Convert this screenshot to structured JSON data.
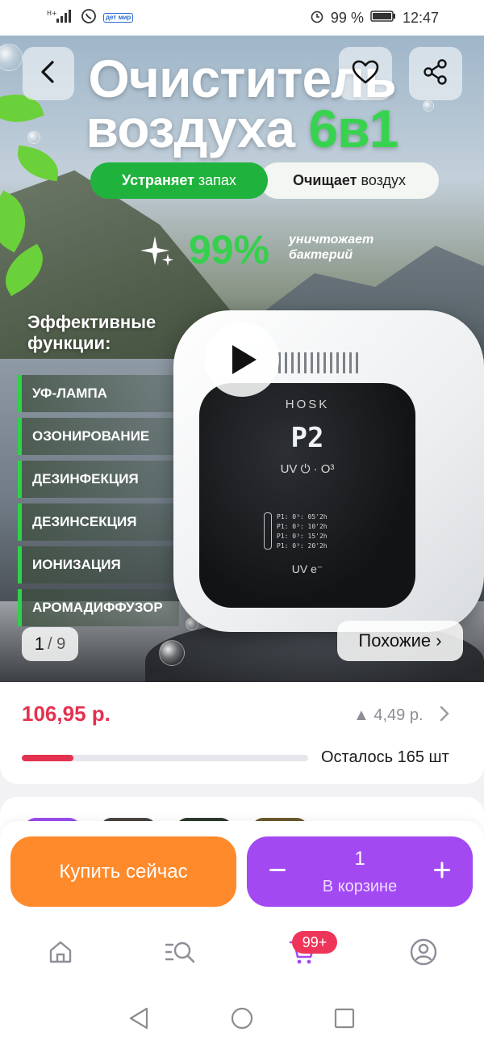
{
  "status_bar": {
    "signal_text": "H+",
    "app_badge": "дет мир",
    "battery_pct": "99 %",
    "time": "12:47"
  },
  "hero": {
    "title_line1": "Очиститель",
    "title_line2": "воздуха",
    "title_accent": "6в1",
    "pill_left_bold": "Устраняет",
    "pill_left_rest": "запах",
    "pill_right_bold": "Очищает",
    "pill_right_rest": "воздух",
    "percent": "99%",
    "percent_label_1": "уничтожает",
    "percent_label_2": "бактерий",
    "functions_title_1": "Эффективные",
    "functions_title_2": "функции:",
    "features": [
      "УФ-ЛАМПА",
      "ОЗОНИРОВАНИЕ",
      "ДЕЗИНФЕКЦИЯ",
      "ДЕЗИНСЕКЦИЯ",
      "ИОНИЗАЦИЯ",
      "АРОМАДИФФУЗОР"
    ],
    "device_brand": "HOSK",
    "device_display": "P2",
    "device_row1": "UV  ⏻  · O³",
    "device_timers": [
      "P1: 0³: 05'2h",
      "P1: 0³: 10'2h",
      "P1: 0³: 15'2h",
      "P1: 0³: 20'2h"
    ],
    "device_row2": "UV   e⁻",
    "image_index": "1",
    "image_total": "/ 9",
    "similar_label": "Похожие ›",
    "accent_color": "#37d34f"
  },
  "price_card": {
    "price": "106,95 р.",
    "delta": "▲ 4,49 р.",
    "stock_text": "Осталось 165 шт",
    "stock_fraction": 0.18,
    "price_color": "#e4314f"
  },
  "actions": {
    "buy_label": "Купить сейчас",
    "cart_qty": "1",
    "cart_label": "В корзине",
    "buy_color": "#ff8a2b",
    "cart_color": "#a349f2"
  },
  "bottom_nav": {
    "items": [
      "home-icon",
      "catalog-search-icon",
      "cart-icon",
      "profile-icon"
    ],
    "cart_badge": "99+"
  }
}
